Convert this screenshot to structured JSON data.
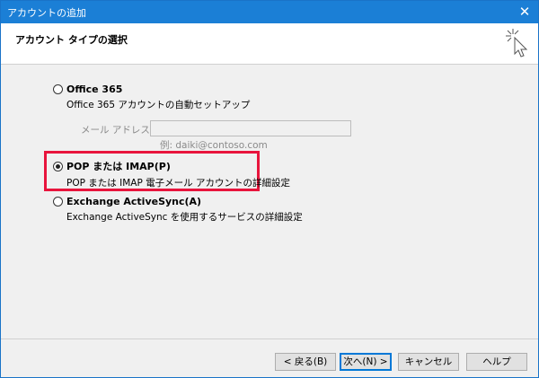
{
  "window": {
    "title": "アカウントの追加",
    "close_glyph": "✕"
  },
  "header": {
    "title": "アカウント タイプの選択"
  },
  "options": {
    "office365": {
      "label": "Office 365",
      "desc": "Office 365 アカウントの自動セットアップ",
      "email_label": "メール アドレス(E):",
      "email_value": "",
      "example": "例: daiki@contoso.com",
      "selected": false
    },
    "pop_imap": {
      "label": "POP または IMAP(P)",
      "desc": "POP または IMAP 電子メール アカウントの詳細設定",
      "selected": true
    },
    "exchange": {
      "label": "Exchange ActiveSync(A)",
      "desc": "Exchange ActiveSync を使用するサービスの詳細設定",
      "selected": false
    }
  },
  "buttons": {
    "back": "< 戻る(B)",
    "next": "次へ(N) >",
    "cancel": "キャンセル",
    "help": "ヘルプ"
  },
  "colors": {
    "titlebar": "#1b7fd6",
    "highlight": "#e8143c"
  },
  "icons": {
    "header": "cursor-click-icon"
  }
}
